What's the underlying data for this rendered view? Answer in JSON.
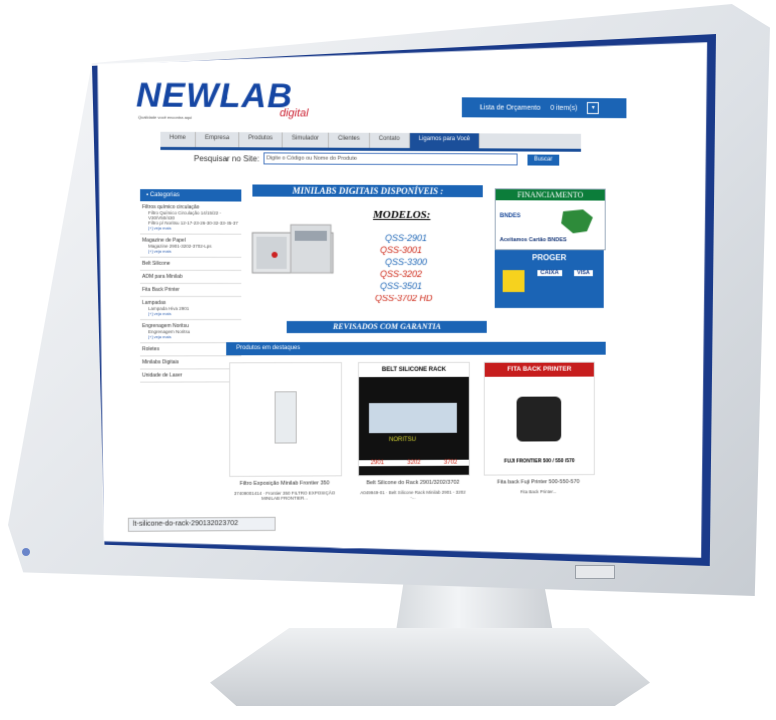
{
  "site": {
    "logo": "NEWLAB",
    "logo_sub": "digital",
    "tagline": "Qualidade você encontra aqui",
    "cart_label": "Lista de Orçamento",
    "cart_count": "0 item(s)"
  },
  "nav": [
    "Home",
    "Empresa",
    "Produtos",
    "Simulador",
    "Clientes",
    "Contato",
    "Ligamos para Você"
  ],
  "search": {
    "label": "Pesquisar no Site:",
    "placeholder": "Digite o Código ou Nome do Produto",
    "button": "Buscar"
  },
  "sidebar": {
    "title": "Categorias",
    "items": [
      {
        "label": "Filtros químico circulação",
        "subs": [
          "Filtro Químico Circulação 14/15/22 - V30/V50/430",
          "Filtro p/ Noritsu 12-17-23-26-30-32-33-35-37"
        ],
        "more": "[+] veja mais"
      },
      {
        "label": "Magazine de Papel",
        "subs": [
          "Magazine 2901-3202-3702-Lps"
        ],
        "more": "[+] veja mais"
      },
      {
        "label": "Belt Silicone",
        "subs": [],
        "more": ""
      },
      {
        "label": "ADM para Minilab",
        "subs": [],
        "more": ""
      },
      {
        "label": "Fita Back Printer",
        "subs": [],
        "more": ""
      },
      {
        "label": "Lampadas",
        "subs": [
          "Lampada Hiva 2901"
        ],
        "more": "[+] veja mais"
      },
      {
        "label": "Engrenagem Noritsu",
        "subs": [
          "Engrenagem Noritsu"
        ],
        "more": "[+] veja mais"
      },
      {
        "label": "Roletes",
        "subs": [],
        "more": ""
      },
      {
        "label": "Minilabs Digitais",
        "subs": [],
        "more": ""
      },
      {
        "label": "Unidade de Laser",
        "subs": [],
        "more": ""
      }
    ]
  },
  "banner": {
    "title": "MINILABS DIGITAIS DISPONÍVEIS :",
    "models_title": "MODELOS:",
    "models": [
      "QSS-2901",
      "QSS-3001",
      "QSS-3300",
      "QSS-3202",
      "QSS-3501",
      "QSS-3702 HD"
    ],
    "bottom": "REVISADOS COM GARANTIA"
  },
  "financing": {
    "title": "FINANCIAMENTO",
    "logo": "BNDES",
    "note": "Aceitamos Cartão BNDES",
    "proger": "PROGER",
    "caixa": "CAIXA",
    "visa": "VISA"
  },
  "products": {
    "title": "Produtos em destaques",
    "items": [
      {
        "name": "Filtro Exposição Minilab Frontier 350",
        "desc": "37409001414 · Frontier 350 FILTRO EXPOSIÇÃO MINILAB FRONTIER..."
      },
      {
        "name": "Belt Silicone do Rack 2901/3202/3702",
        "desc": "A049949-01 · Belt Silicone Rack Minilab 2901 - 3202 -...",
        "img_title": "BELT SILICONE RACK",
        "img_brand": "NORITSU",
        "img_nums": [
          "2901",
          "3202",
          "3702"
        ]
      },
      {
        "name": "Fita back Fuji Printer 500-550-570",
        "desc": "Fita Back Printer...",
        "img_title": "FITA BACK PRINTER",
        "img_caption": "FUJI FRONTIER 500 / 550 /570"
      }
    ]
  },
  "status_url": "lt-silicone-do-rack-290132023702",
  "colors": {
    "accent": "#1b64b5",
    "logo": "#1546a3",
    "fin_green": "#0c7d3a"
  }
}
